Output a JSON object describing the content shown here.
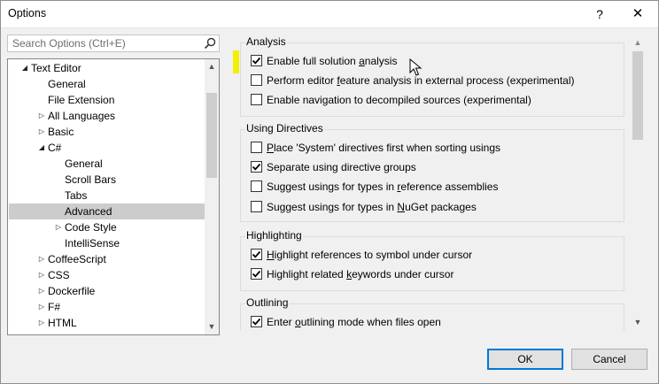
{
  "window": {
    "title": "Options",
    "help_glyph": "?",
    "close_glyph": "✕"
  },
  "search": {
    "placeholder": "Search Options (Ctrl+E)"
  },
  "tree": {
    "items": [
      {
        "label": "Text Editor",
        "arrow": "down",
        "level": 0
      },
      {
        "label": "General",
        "arrow": "none",
        "level": 1
      },
      {
        "label": "File Extension",
        "arrow": "none",
        "level": 1
      },
      {
        "label": "All Languages",
        "arrow": "right",
        "level": 1
      },
      {
        "label": "Basic",
        "arrow": "right",
        "level": 1
      },
      {
        "label": "C#",
        "arrow": "down",
        "level": 1
      },
      {
        "label": "General",
        "arrow": "none",
        "level": 2
      },
      {
        "label": "Scroll Bars",
        "arrow": "none",
        "level": 2
      },
      {
        "label": "Tabs",
        "arrow": "none",
        "level": 2
      },
      {
        "label": "Advanced",
        "arrow": "none",
        "level": 2,
        "selected": true
      },
      {
        "label": "Code Style",
        "arrow": "right",
        "level": 2
      },
      {
        "label": "IntelliSense",
        "arrow": "none",
        "level": 2
      },
      {
        "label": "CoffeeScript",
        "arrow": "right",
        "level": 1
      },
      {
        "label": "CSS",
        "arrow": "right",
        "level": 1
      },
      {
        "label": "Dockerfile",
        "arrow": "right",
        "level": 1
      },
      {
        "label": "F#",
        "arrow": "right",
        "level": 1
      },
      {
        "label": "HTML",
        "arrow": "right",
        "level": 1
      }
    ]
  },
  "groups": [
    {
      "title": "Analysis",
      "options": [
        {
          "pre": "Enable full solution ",
          "u": "a",
          "post": "nalysis",
          "checked": true
        },
        {
          "pre": "Perform editor ",
          "u": "f",
          "post": "eature analysis in external process (experimental)",
          "checked": false
        },
        {
          "pre": "Enable navigation to decompiled sources (experimental)",
          "u": "",
          "post": "",
          "checked": false
        }
      ]
    },
    {
      "title": "Using Directives",
      "options": [
        {
          "pre": "",
          "u": "P",
          "post": "lace 'System' directives first when sorting usings",
          "checked": false
        },
        {
          "pre": "Separate using directive groups",
          "u": "",
          "post": "",
          "checked": true
        },
        {
          "pre": "Suggest usings for types in ",
          "u": "r",
          "post": "eference assemblies",
          "checked": false
        },
        {
          "pre": "Suggest usings for types in ",
          "u": "N",
          "post": "uGet packages",
          "checked": false
        }
      ]
    },
    {
      "title": "Highlighting",
      "options": [
        {
          "pre": "",
          "u": "H",
          "post": "ighlight references to symbol under cursor",
          "checked": true
        },
        {
          "pre": "Highlight related ",
          "u": "k",
          "post": "eywords under cursor",
          "checked": true
        }
      ]
    },
    {
      "title": "Outlining",
      "options": [
        {
          "pre": "Enter ",
          "u": "o",
          "post": "utlining mode when files open",
          "checked": true
        }
      ]
    }
  ],
  "buttons": {
    "ok": "OK",
    "cancel": "Cancel"
  },
  "colors": {
    "highlight": "#f0f000",
    "accent": "#0078d7",
    "selection": "#cccccc"
  },
  "icons": {
    "search": "search-icon",
    "checkmark": "checkmark-icon",
    "cursor": "mouse-cursor-icon"
  }
}
